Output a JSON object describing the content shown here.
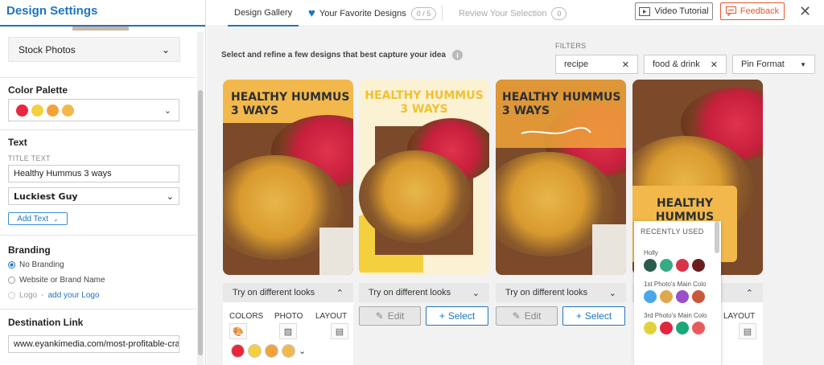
{
  "sidebar": {
    "title": "Design Settings",
    "stock_photos": "Stock Photos",
    "color_palette": {
      "heading": "Color Palette",
      "colors": [
        "#e8263e",
        "#f4d03f",
        "#f0a33a",
        "#f2b84b"
      ]
    },
    "text": {
      "heading": "Text",
      "title_label": "TITLE TEXT",
      "title_value": "Healthy Hummus 3 ways",
      "font": "Luckiest Guy",
      "add_text": "Add Text"
    },
    "branding": {
      "heading": "Branding",
      "options": [
        "No Branding",
        "Website or Brand Name",
        "Logo"
      ],
      "logo_link": "add your Logo",
      "logo_dash": "-"
    },
    "destination": {
      "heading": "Destination Link",
      "value": "www.eyankimedia.com/most-profitable-craf"
    }
  },
  "topbar": {
    "tab_gallery": "Design Gallery",
    "tab_favorites": "Your Favorite Designs",
    "favorites_count": "0 / 5",
    "tab_review": "Review Your Selection",
    "review_count": "0",
    "video_tutorial": "Video Tutorial",
    "feedback": "Feedback"
  },
  "main": {
    "instruction": "Select and refine a few designs that best capture your idea",
    "filters_label": "FILTERS",
    "filters": [
      "recipe",
      "food & drink"
    ],
    "format": "Pin Format",
    "card_title": [
      "HEALTHY HUMMUS",
      "3 WAYS"
    ],
    "card4_title": [
      "HEALTHY",
      "HUMMUS"
    ],
    "looks_label": "Try on different looks",
    "edit": "Edit",
    "select": "Select",
    "colors_label": "COLORS",
    "photo_label": "PHOTO",
    "layout_label": "LAYOUT",
    "look_dots": [
      "#e8263e",
      "#f4d03f",
      "#f0a33a",
      "#f2b84b"
    ],
    "popup": {
      "heading": "RECENTLY USED",
      "groups": [
        {
          "name": "Holly",
          "colors": [
            "#2b5a4f",
            "#3aa985",
            "#d9334a",
            "#6a1d1e"
          ]
        },
        {
          "name": "1st Photo's Main Colo",
          "colors": [
            "#4aa8e8",
            "#e0a84d",
            "#9b4ec9",
            "#c9583a"
          ]
        },
        {
          "name": "3rd Photo's Main Colo",
          "colors": [
            "#e2d13a",
            "#e0263f",
            "#1aa87a",
            "#e85b5b"
          ]
        }
      ]
    }
  }
}
